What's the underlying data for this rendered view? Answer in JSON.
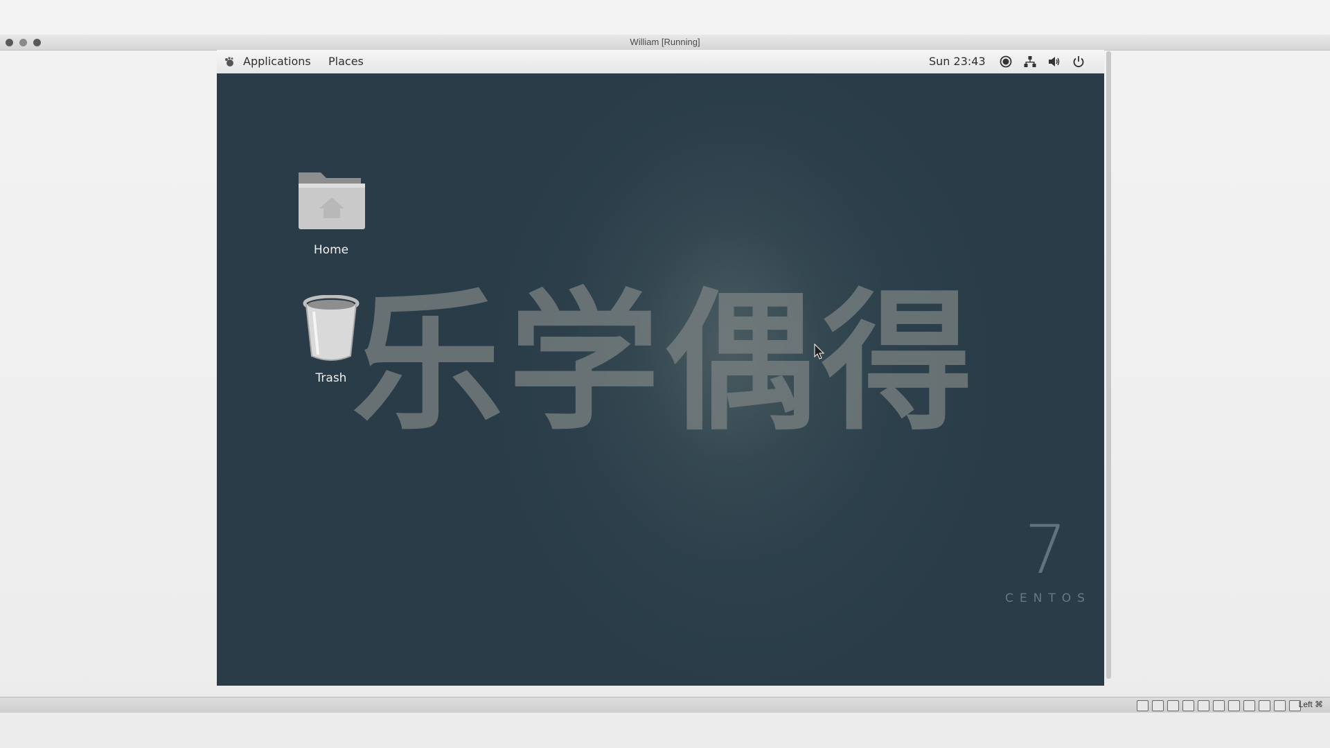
{
  "window": {
    "title": "William [Running]"
  },
  "gnome_panel": {
    "applications_label": "Applications",
    "places_label": "Places",
    "clock": "Sun 23:43",
    "tray_icons": [
      "accessibility-icon",
      "network-icon",
      "volume-icon",
      "power-icon"
    ]
  },
  "desktop": {
    "icons": [
      {
        "label": "Home",
        "icon": "folder-home-icon"
      },
      {
        "label": "Trash",
        "icon": "trash-icon"
      }
    ],
    "wallpaper_text": "乐学偶得",
    "wallpaper_version": "7",
    "wallpaper_brand": "CENTOS"
  },
  "status_bar": {
    "host_key": "Left ⌘"
  },
  "colors": {
    "desktop_bg": "#293c48",
    "panel_bg": "#efefef"
  }
}
